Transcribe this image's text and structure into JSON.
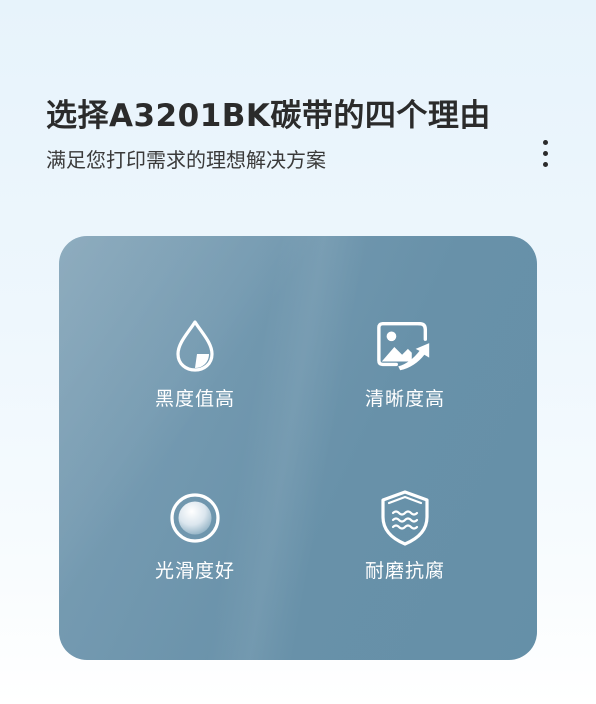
{
  "header": {
    "title": "选择A3201BK碳带的四个理由",
    "subtitle": "满足您打印需求的理想解决方案"
  },
  "menu": {
    "icon": "more-vertical-icon"
  },
  "features": [
    {
      "label": "黑度值高",
      "icon": "ink-drop-icon"
    },
    {
      "label": "清晰度高",
      "icon": "image-arrow-icon"
    },
    {
      "label": "光滑度好",
      "icon": "smooth-sphere-icon"
    },
    {
      "label": "耐磨抗腐",
      "icon": "shield-wave-icon"
    }
  ],
  "colors": {
    "card": "#6f96ad",
    "text_on_card": "#ffffff",
    "title": "#2b2b2b"
  }
}
